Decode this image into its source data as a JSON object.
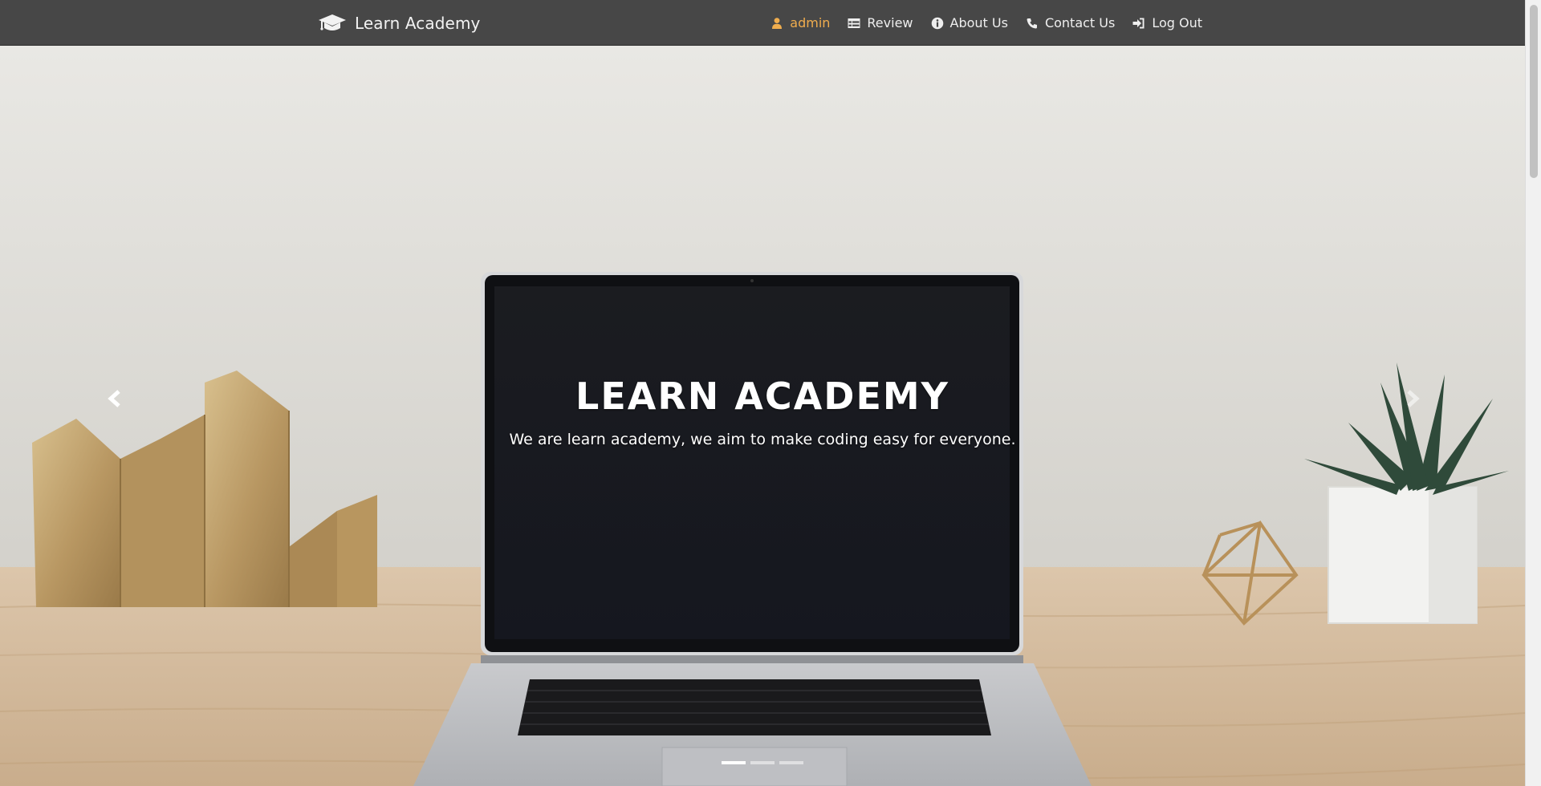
{
  "brand": {
    "name": "Learn Academy",
    "icon": "graduation-cap-icon"
  },
  "nav": {
    "items": [
      {
        "label": "admin",
        "icon": "user-icon"
      },
      {
        "label": "Review",
        "icon": "table-list-icon"
      },
      {
        "label": "About Us",
        "icon": "info-circle-icon"
      },
      {
        "label": "Contact Us",
        "icon": "phone-icon"
      },
      {
        "label": "Log Out",
        "icon": "sign-in-icon"
      }
    ]
  },
  "carousel": {
    "title": "LEARN ACADEMY",
    "subtitle": "We are learn academy, we aim to make coding easy for everyone.",
    "slide_count": 3,
    "active_slide": 1
  },
  "colors": {
    "navbar": "#474747",
    "user_accent": "#f0ad4e",
    "nav_text": "#efefef"
  }
}
